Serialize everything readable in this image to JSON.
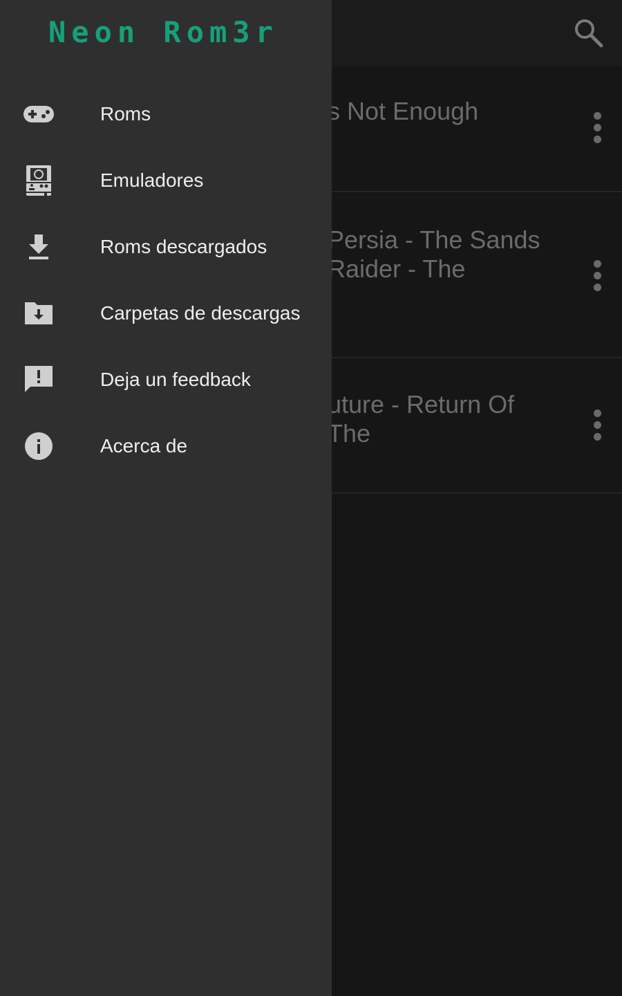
{
  "app": {
    "logo_text": "Neon Rom3r",
    "search_icon": "search-icon",
    "rows": [
      {
        "title": "s Not Enough",
        "menu_icon": "more-vert-icon"
      },
      {
        "title": "Persia - The Sands\nRaider - The",
        "menu_icon": "more-vert-icon"
      },
      {
        "title": "uture - Return Of The",
        "menu_icon": "more-vert-icon"
      }
    ]
  },
  "drawer": {
    "items": [
      {
        "label": "Roms",
        "icon": "gamepad-icon"
      },
      {
        "label": "Emuladores",
        "icon": "arcade-machine-icon"
      },
      {
        "label": "Roms descargados",
        "icon": "download-icon"
      },
      {
        "label": "Carpetas de descargas",
        "icon": "download-folder-icon"
      },
      {
        "label": "Deja un feedback",
        "icon": "feedback-icon"
      },
      {
        "label": "Acerca de",
        "icon": "info-icon"
      }
    ]
  },
  "colors": {
    "accent": "#16a07a",
    "drawer_bg": "#2f2f2f",
    "screen_bg": "#151515",
    "icon": "#cfcfcf"
  }
}
